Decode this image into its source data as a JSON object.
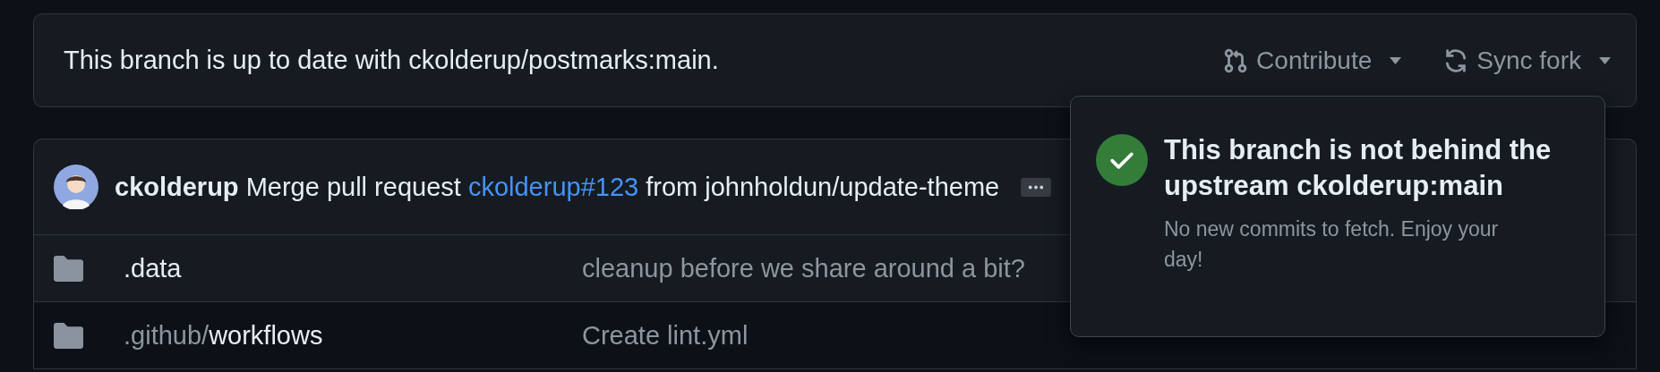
{
  "sync_banner": {
    "message": "This branch is up to date with ckolderup/postmarks:main.",
    "buttons": [
      {
        "kind": "contribute",
        "label": "Contribute"
      },
      {
        "kind": "sync",
        "label": "Sync fork"
      }
    ]
  },
  "popover": {
    "title": "This branch is not behind the upstream ckolderup:main",
    "description": "No new commits to fetch. Enjoy your day!"
  },
  "commit": {
    "author": "ckolderup",
    "message_before": "Merge pull request",
    "link": "ckolderup#123",
    "message_after": "from johnholdun/update-theme"
  },
  "files": [
    {
      "name": ".data",
      "message": "cleanup before we share around a bit?"
    },
    {
      "path_prefix": ".github/",
      "name": "workflows",
      "message": "Create lint.yml"
    }
  ]
}
